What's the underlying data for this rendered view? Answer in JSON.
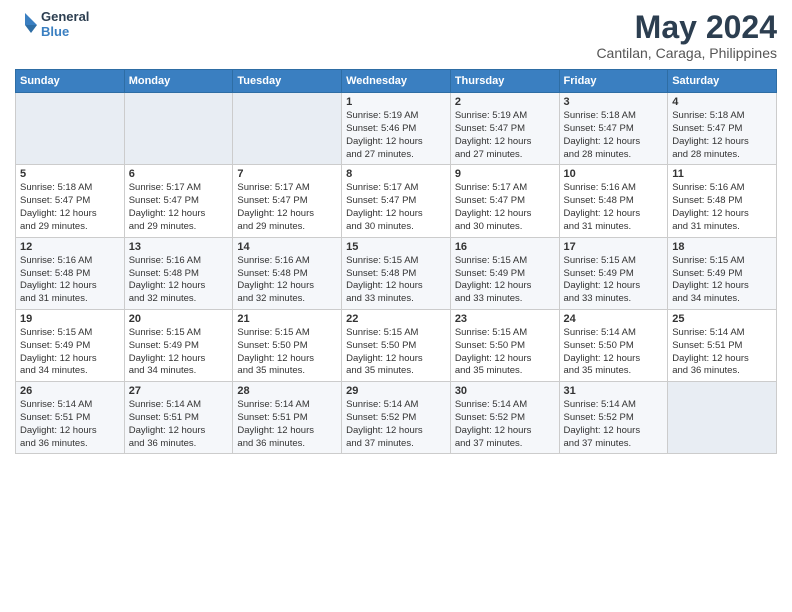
{
  "header": {
    "logo_line1": "General",
    "logo_line2": "Blue",
    "month": "May 2024",
    "location": "Cantilan, Caraga, Philippines"
  },
  "days_of_week": [
    "Sunday",
    "Monday",
    "Tuesday",
    "Wednesday",
    "Thursday",
    "Friday",
    "Saturday"
  ],
  "weeks": [
    [
      {
        "day": "",
        "info": ""
      },
      {
        "day": "",
        "info": ""
      },
      {
        "day": "",
        "info": ""
      },
      {
        "day": "1",
        "info": "Sunrise: 5:19 AM\nSunset: 5:46 PM\nDaylight: 12 hours\nand 27 minutes."
      },
      {
        "day": "2",
        "info": "Sunrise: 5:19 AM\nSunset: 5:47 PM\nDaylight: 12 hours\nand 27 minutes."
      },
      {
        "day": "3",
        "info": "Sunrise: 5:18 AM\nSunset: 5:47 PM\nDaylight: 12 hours\nand 28 minutes."
      },
      {
        "day": "4",
        "info": "Sunrise: 5:18 AM\nSunset: 5:47 PM\nDaylight: 12 hours\nand 28 minutes."
      }
    ],
    [
      {
        "day": "5",
        "info": "Sunrise: 5:18 AM\nSunset: 5:47 PM\nDaylight: 12 hours\nand 29 minutes."
      },
      {
        "day": "6",
        "info": "Sunrise: 5:17 AM\nSunset: 5:47 PM\nDaylight: 12 hours\nand 29 minutes."
      },
      {
        "day": "7",
        "info": "Sunrise: 5:17 AM\nSunset: 5:47 PM\nDaylight: 12 hours\nand 29 minutes."
      },
      {
        "day": "8",
        "info": "Sunrise: 5:17 AM\nSunset: 5:47 PM\nDaylight: 12 hours\nand 30 minutes."
      },
      {
        "day": "9",
        "info": "Sunrise: 5:17 AM\nSunset: 5:47 PM\nDaylight: 12 hours\nand 30 minutes."
      },
      {
        "day": "10",
        "info": "Sunrise: 5:16 AM\nSunset: 5:48 PM\nDaylight: 12 hours\nand 31 minutes."
      },
      {
        "day": "11",
        "info": "Sunrise: 5:16 AM\nSunset: 5:48 PM\nDaylight: 12 hours\nand 31 minutes."
      }
    ],
    [
      {
        "day": "12",
        "info": "Sunrise: 5:16 AM\nSunset: 5:48 PM\nDaylight: 12 hours\nand 31 minutes."
      },
      {
        "day": "13",
        "info": "Sunrise: 5:16 AM\nSunset: 5:48 PM\nDaylight: 12 hours\nand 32 minutes."
      },
      {
        "day": "14",
        "info": "Sunrise: 5:16 AM\nSunset: 5:48 PM\nDaylight: 12 hours\nand 32 minutes."
      },
      {
        "day": "15",
        "info": "Sunrise: 5:15 AM\nSunset: 5:48 PM\nDaylight: 12 hours\nand 33 minutes."
      },
      {
        "day": "16",
        "info": "Sunrise: 5:15 AM\nSunset: 5:49 PM\nDaylight: 12 hours\nand 33 minutes."
      },
      {
        "day": "17",
        "info": "Sunrise: 5:15 AM\nSunset: 5:49 PM\nDaylight: 12 hours\nand 33 minutes."
      },
      {
        "day": "18",
        "info": "Sunrise: 5:15 AM\nSunset: 5:49 PM\nDaylight: 12 hours\nand 34 minutes."
      }
    ],
    [
      {
        "day": "19",
        "info": "Sunrise: 5:15 AM\nSunset: 5:49 PM\nDaylight: 12 hours\nand 34 minutes."
      },
      {
        "day": "20",
        "info": "Sunrise: 5:15 AM\nSunset: 5:49 PM\nDaylight: 12 hours\nand 34 minutes."
      },
      {
        "day": "21",
        "info": "Sunrise: 5:15 AM\nSunset: 5:50 PM\nDaylight: 12 hours\nand 35 minutes."
      },
      {
        "day": "22",
        "info": "Sunrise: 5:15 AM\nSunset: 5:50 PM\nDaylight: 12 hours\nand 35 minutes."
      },
      {
        "day": "23",
        "info": "Sunrise: 5:15 AM\nSunset: 5:50 PM\nDaylight: 12 hours\nand 35 minutes."
      },
      {
        "day": "24",
        "info": "Sunrise: 5:14 AM\nSunset: 5:50 PM\nDaylight: 12 hours\nand 35 minutes."
      },
      {
        "day": "25",
        "info": "Sunrise: 5:14 AM\nSunset: 5:51 PM\nDaylight: 12 hours\nand 36 minutes."
      }
    ],
    [
      {
        "day": "26",
        "info": "Sunrise: 5:14 AM\nSunset: 5:51 PM\nDaylight: 12 hours\nand 36 minutes."
      },
      {
        "day": "27",
        "info": "Sunrise: 5:14 AM\nSunset: 5:51 PM\nDaylight: 12 hours\nand 36 minutes."
      },
      {
        "day": "28",
        "info": "Sunrise: 5:14 AM\nSunset: 5:51 PM\nDaylight: 12 hours\nand 36 minutes."
      },
      {
        "day": "29",
        "info": "Sunrise: 5:14 AM\nSunset: 5:52 PM\nDaylight: 12 hours\nand 37 minutes."
      },
      {
        "day": "30",
        "info": "Sunrise: 5:14 AM\nSunset: 5:52 PM\nDaylight: 12 hours\nand 37 minutes."
      },
      {
        "day": "31",
        "info": "Sunrise: 5:14 AM\nSunset: 5:52 PM\nDaylight: 12 hours\nand 37 minutes."
      },
      {
        "day": "",
        "info": ""
      }
    ]
  ]
}
